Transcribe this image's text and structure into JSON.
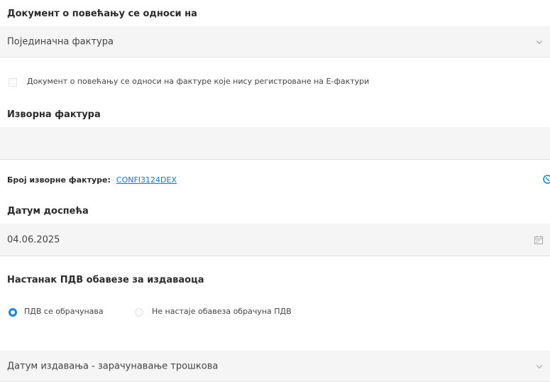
{
  "reference_section": {
    "label": "Документ о повећању се односи на",
    "select_value": "Појединачна фактура"
  },
  "unregistered_checkbox": {
    "label": "Документ о повећању се односи на фактуре које нису регистроване на Е-фактури",
    "checked": false
  },
  "source_invoice": {
    "label": "Изворна фактура",
    "input_value": "",
    "number_label": "Број изворне фактуре:",
    "number_value": "CONFI3124DEX"
  },
  "due_date": {
    "label": "Датум доспећа",
    "value": "04.06.2025"
  },
  "vat_obligation": {
    "label": "Настанак ПДВ обавезе за издаваоца",
    "options": [
      {
        "label": "ПДВ се обрачунава",
        "selected": true
      },
      {
        "label": "Не настаје обавеза обрачуна ПДВ",
        "selected": false
      }
    ],
    "select_value": "Датум издавања - зарачунавање трошкова"
  },
  "colors": {
    "accent": "#1a86d8",
    "link": "#1a73c8",
    "field_background": "#f5f5f5"
  }
}
